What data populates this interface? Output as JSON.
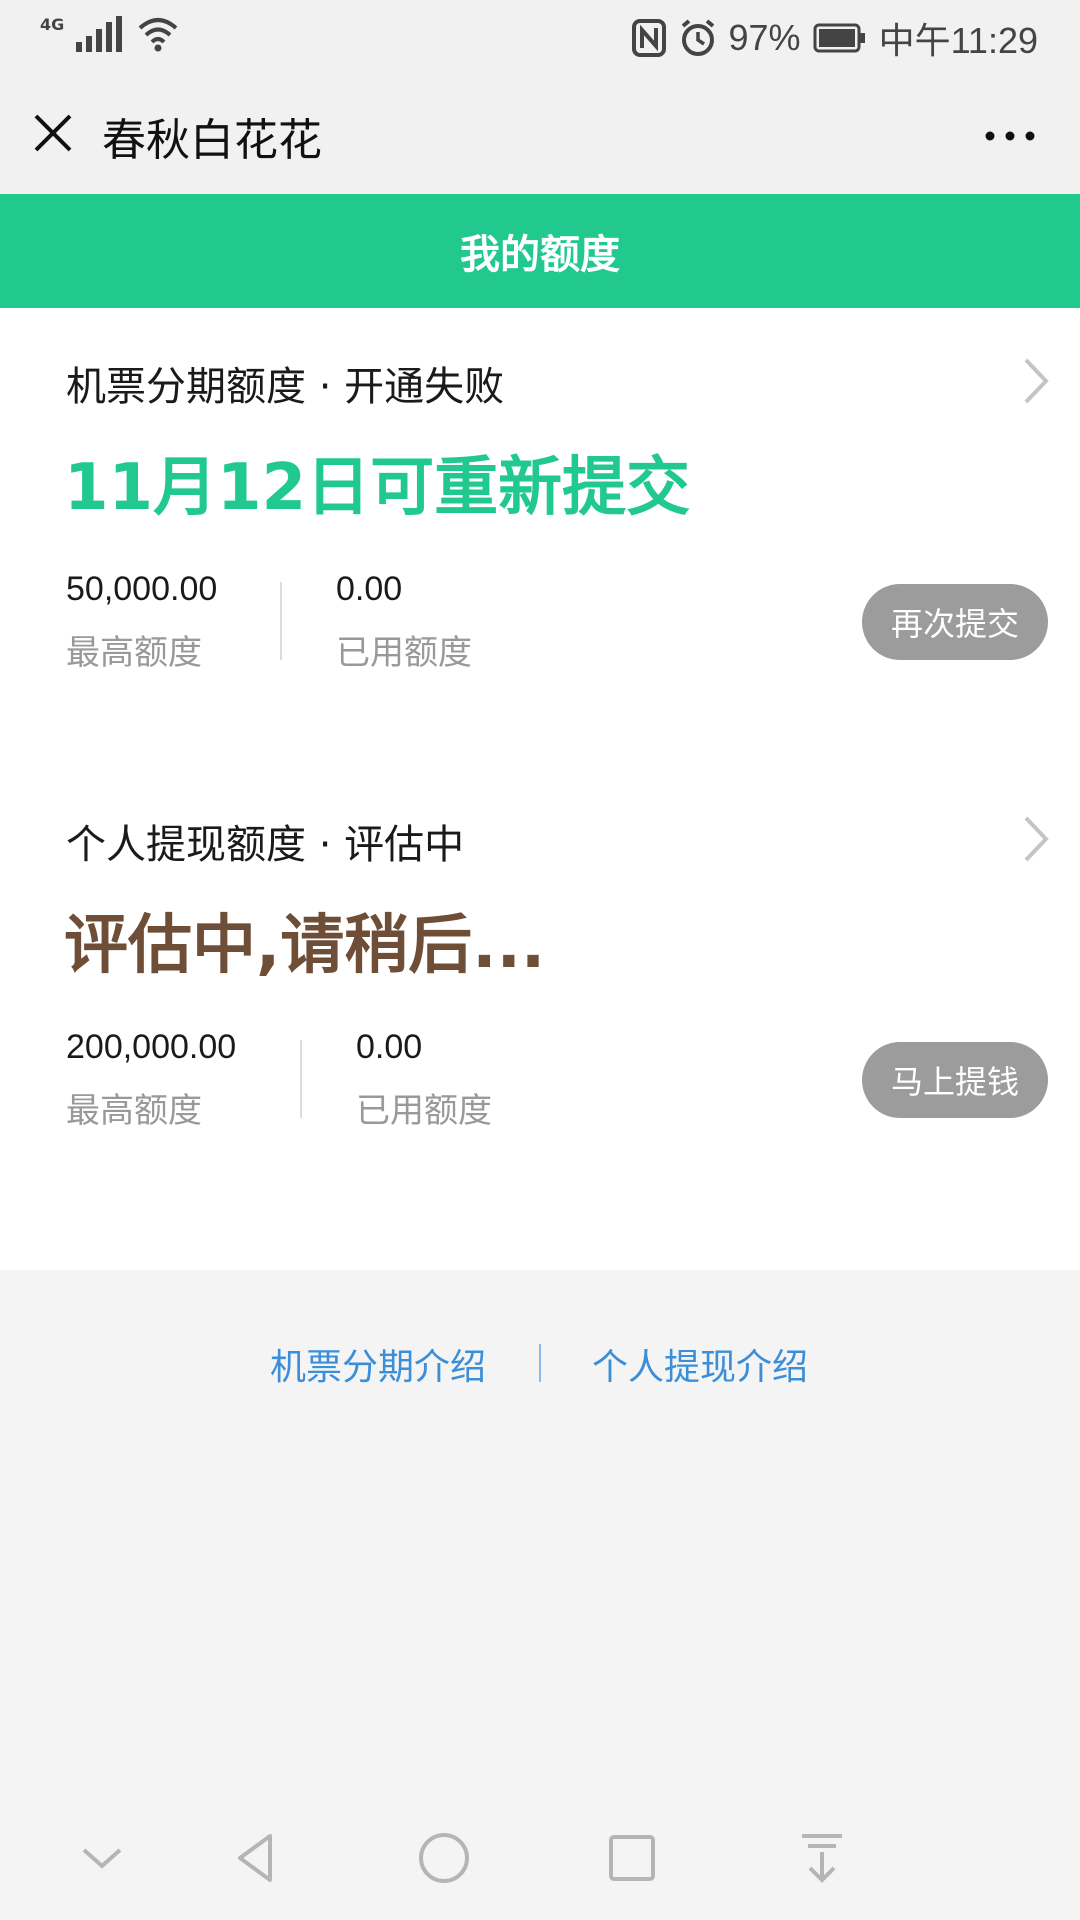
{
  "status_bar": {
    "network": "4G",
    "battery_percent": "97%",
    "time": "中午11:29"
  },
  "title_bar": {
    "title": "春秋白花花"
  },
  "header": {
    "title": "我的额度"
  },
  "cards": [
    {
      "title": "机票分期额度 · 开通失败",
      "headline": "11月12日可重新提交",
      "headline_color": "#21c98f",
      "max_value": "50,000.00",
      "max_label": "最高额度",
      "used_value": "0.00",
      "used_label": "已用额度",
      "button_label": "再次提交"
    },
    {
      "title": "个人提现额度 · 评估中",
      "headline": "评估中,请稍后...",
      "headline_color": "#6f4e37",
      "max_value": "200,000.00",
      "max_label": "最高额度",
      "used_value": "0.00",
      "used_label": "已用额度",
      "button_label": "马上提钱"
    }
  ],
  "footer_links": {
    "link1": "机票分期介绍",
    "link2": "个人提现介绍"
  },
  "colors": {
    "accent_green": "#21c98f",
    "link_blue": "#3b8fd9",
    "button_grey": "#9c9c9c"
  }
}
